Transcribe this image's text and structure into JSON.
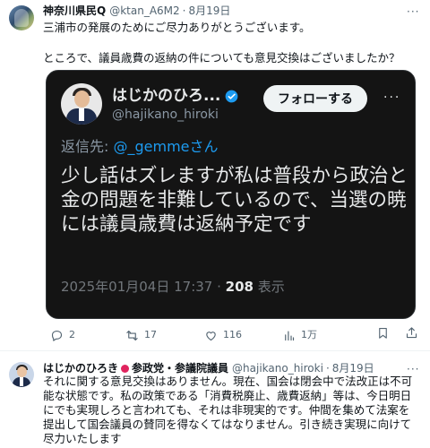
{
  "tweet1": {
    "author_name": "神奈川県民Q",
    "handle": "@ktan_A6M2",
    "separator": "·",
    "date": "8月19日",
    "text_line1": "三浦市の発展のためにご尽力ありがとうございます。",
    "text_line2": "ところで、議員歳費の返納の件についても意見交換はございましたか？",
    "media": {
      "author_name": "はじかのひろ...",
      "handle": "@hajikano_hiroki",
      "follow_label": "フォローする",
      "reply_prefix": "返信先: ",
      "reply_to": "@_gemmeさん",
      "text": "少し話はズレますが私は普段から政治と金の問題を非難しているので、当選の暁には議員歳費は返納予定です",
      "timestamp": "2025年01月04日 17:37 · ",
      "views_count": "208",
      "views_label": " 表示"
    },
    "actions": {
      "reply_count": "2",
      "retweet_count": "17",
      "like_count": "116",
      "views_count": "1万"
    }
  },
  "tweet2": {
    "author_name": "はじかのひろき",
    "affiliation": "参政党・参議院議員",
    "handle": "@hajikano_hiroki",
    "separator": "·",
    "date": "8月19日",
    "text": "それに関する意見交換はありません。現在、国会は閉会中で法改正は不可能な状態です。私の政策である「消費税廃止、歳費返納」等は、今日明日にでも実現しろと言われても、それは非現実的です。仲間を集めて法案を提出して国会議員の賛同を得なくてはなりません。引き続き実現に向けて尽力いたします"
  },
  "colors": {
    "text_primary": "#0f1419",
    "text_secondary": "#536471",
    "accent_blue": "#1d9bf0",
    "media_background": "#141414"
  },
  "icons": [
    "more-icon",
    "verified-badge-icon",
    "reply-icon",
    "retweet-icon",
    "like-icon",
    "views-icon",
    "bookmark-icon",
    "share-icon",
    "party-flag-icon"
  ]
}
